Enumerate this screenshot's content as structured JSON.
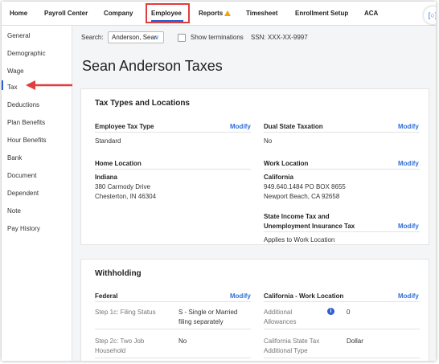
{
  "topnav": {
    "items": [
      "Home",
      "Payroll Center",
      "Company",
      "Employee",
      "Reports",
      "Timesheet",
      "Enrollment Setup",
      "ACA"
    ],
    "active": "Employee"
  },
  "sidebar": {
    "items": [
      "General",
      "Demographic",
      "Wage",
      "Tax",
      "Deductions",
      "Plan Benefits",
      "Hour Benefits",
      "Bank",
      "Document",
      "Dependent",
      "Note",
      "Pay History"
    ],
    "active": "Tax"
  },
  "search": {
    "label": "Search:",
    "value": "Anderson, Sear",
    "show_terminations": "Show terminations",
    "ssn": "SSN: XXX-XX-9997"
  },
  "page_title": "Sean Anderson Taxes",
  "tax_types": {
    "title": "Tax Types and Locations",
    "employee_tax_type": {
      "label": "Employee Tax Type",
      "modify": "Modify",
      "value": "Standard"
    },
    "dual_state": {
      "label": "Dual State Taxation",
      "modify": "Modify",
      "value": "No"
    },
    "home_location": {
      "label": "Home Location",
      "line1": "Indiana",
      "line2": "380 Carmody Drive",
      "line3": "Chesterton, IN 46304"
    },
    "work_location": {
      "label": "Work Location",
      "modify": "Modify",
      "line1": "California",
      "line2": "949.640.1484 PO BOX 8655",
      "line3": "Newport Beach, CA 92658"
    },
    "state_income": {
      "label_line1": "State Income Tax and",
      "label_line2": "Unemployment Insurance Tax",
      "modify": "Modify",
      "value": "Applies to Work Location"
    }
  },
  "withholding": {
    "title": "Withholding",
    "federal": {
      "label": "Federal",
      "modify": "Modify",
      "step1c_label": "Step 1c: Filing Status",
      "step1c_value_line1": "S - Single or Married",
      "step1c_value_line2": "filing separately",
      "step2c_label_line1": "Step 2c: Two Job",
      "step2c_label_line2": "Household",
      "step2c_value": "No"
    },
    "california": {
      "label": "California - Work Location",
      "modify": "Modify",
      "allow_label_line1": "Additional",
      "allow_label_line2": "Allowances",
      "allow_info": "i",
      "allow_value": "0",
      "ca_tax_label_line1": "California State Tax",
      "ca_tax_label_line2": "Additional Type",
      "ca_tax_value": "Dollar"
    }
  },
  "colors": {
    "accent": "#2f5ecf",
    "link": "#2f6fd6",
    "highlight": "#e23c3c",
    "warning": "#f0a500"
  }
}
